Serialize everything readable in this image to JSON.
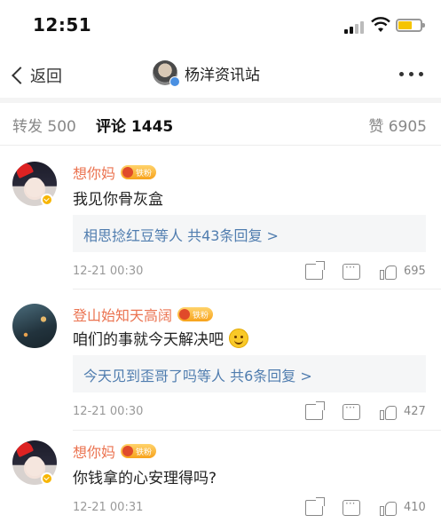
{
  "status_bar": {
    "time": "12:51"
  },
  "nav": {
    "back_label": "返回",
    "title": "杨洋资讯站",
    "more_icon": "more-dots-icon"
  },
  "tabs": {
    "repost": "转发 500",
    "comment": "评论 1445",
    "like": "赞 6905",
    "active": "comment"
  },
  "badge_text": "铁粉",
  "colors": {
    "username": "#eb7350",
    "reply_link": "#507daf",
    "battery": "#f5c400"
  },
  "comments": [
    {
      "name": "想你妈",
      "text": "我见你骨灰盒",
      "replies": "相思捻红豆等人  共43条回复 >",
      "date": "12-21 00:30",
      "likes": "695"
    },
    {
      "name": "登山始知天高阔",
      "text": "咱们的事就今天解决吧",
      "emoji": "smile-emoji",
      "replies": "今天见到歪哥了吗等人  共6条回复 >",
      "date": "12-21 00:30",
      "likes": "427"
    },
    {
      "name": "想你妈",
      "text": "你钱拿的心安理得吗?",
      "date": "12-21 00:31",
      "likes": "410"
    }
  ]
}
